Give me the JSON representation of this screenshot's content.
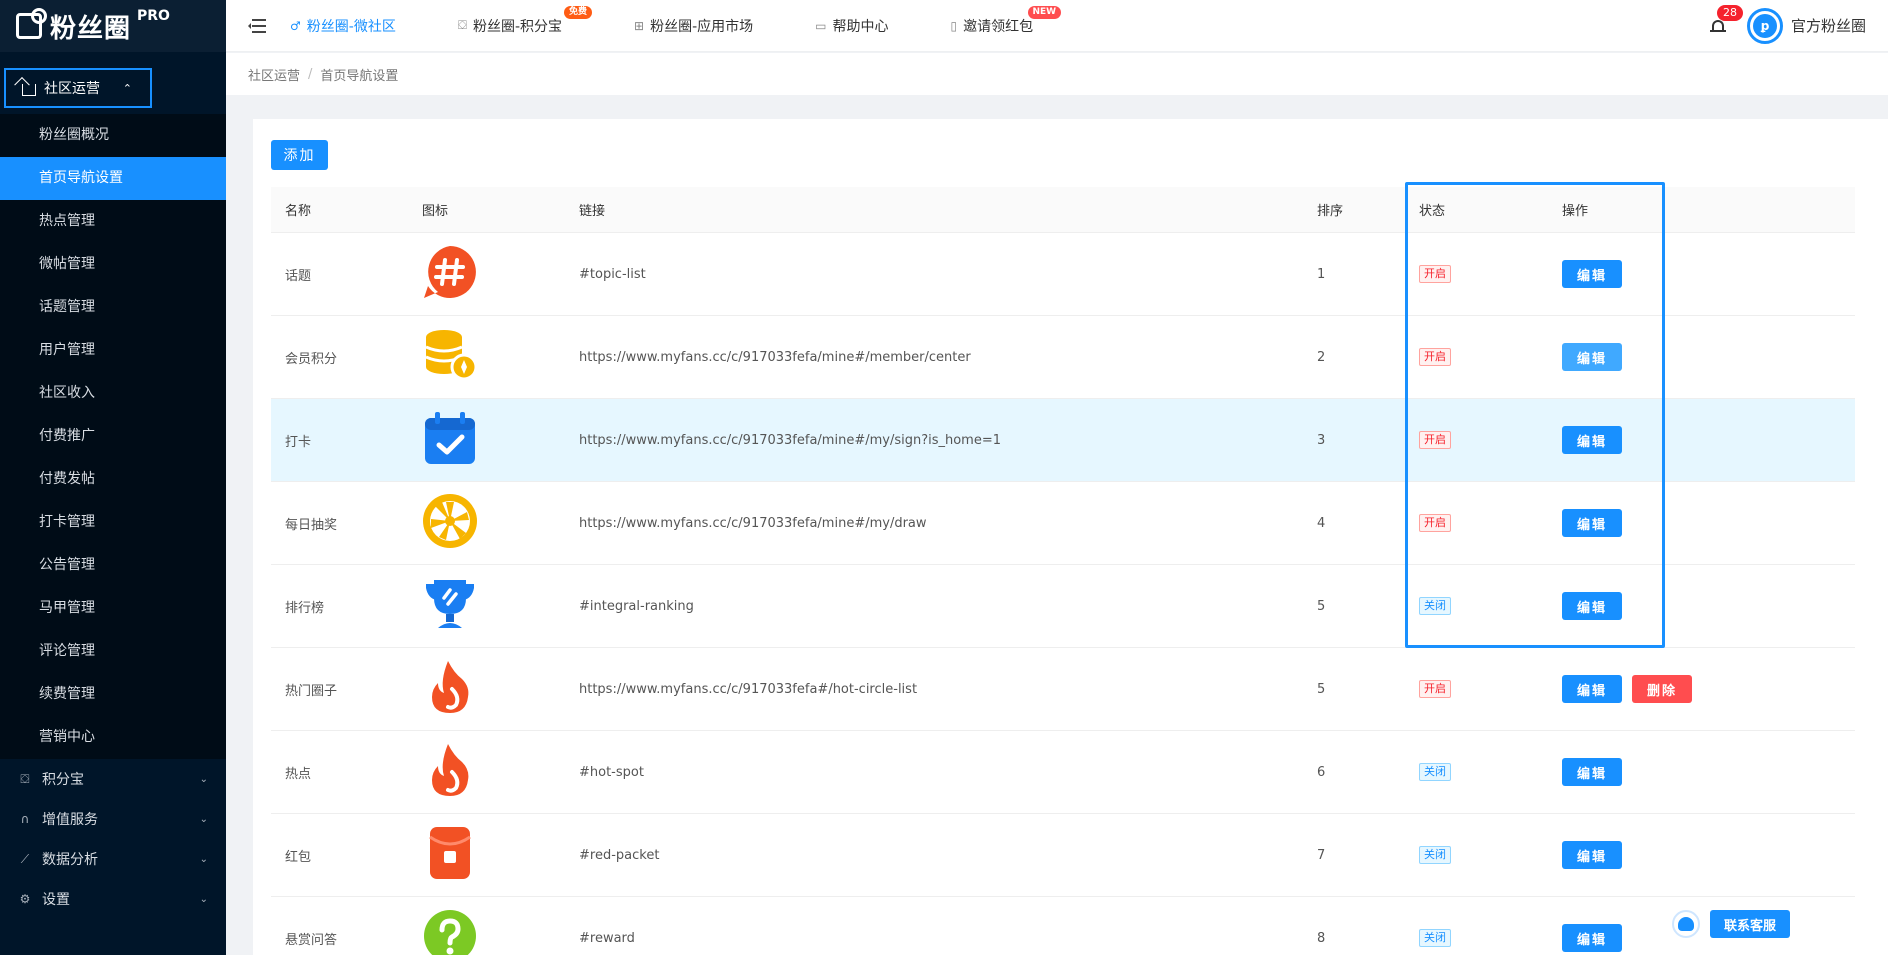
{
  "brand": {
    "name": "粉丝圈",
    "badge": "PRO"
  },
  "sidebar": {
    "group": {
      "label": "社区运营"
    },
    "items": [
      {
        "label": "粉丝圈概况",
        "active": false
      },
      {
        "label": "首页导航设置",
        "active": true
      },
      {
        "label": "热点管理",
        "active": false
      },
      {
        "label": "微帖管理",
        "active": false
      },
      {
        "label": "话题管理",
        "active": false
      },
      {
        "label": "用户管理",
        "active": false
      },
      {
        "label": "社区收入",
        "active": false
      },
      {
        "label": "付费推广",
        "active": false
      },
      {
        "label": "付费发帖",
        "active": false
      },
      {
        "label": "打卡管理",
        "active": false
      },
      {
        "label": "公告管理",
        "active": false
      },
      {
        "label": "马甲管理",
        "active": false
      },
      {
        "label": "评论管理",
        "active": false
      },
      {
        "label": "续费管理",
        "active": false
      },
      {
        "label": "营销中心",
        "active": false
      }
    ],
    "menus": [
      {
        "label": "积分宝",
        "icon": "gift-icon"
      },
      {
        "label": "增值服务",
        "icon": "headset-icon"
      },
      {
        "label": "数据分析",
        "icon": "chart-icon"
      },
      {
        "label": "设置",
        "icon": "gear-icon"
      }
    ]
  },
  "header": {
    "nav": [
      {
        "label": "粉丝圈-微社区",
        "active": true
      },
      {
        "label": "粉丝圈-积分宝",
        "badge": "免费"
      },
      {
        "label": "粉丝圈-应用市场"
      },
      {
        "label": "帮助中心"
      },
      {
        "label": "邀请领红包",
        "badge": "NEW"
      }
    ],
    "notifications": "28",
    "username": "官方粉丝圈"
  },
  "breadcrumb": {
    "root": "社区运营",
    "sep": "/",
    "current": "首页导航设置"
  },
  "actions": {
    "add": "添加",
    "edit": "编辑",
    "delete": "删除"
  },
  "table": {
    "columns": {
      "name": "名称",
      "icon": "图标",
      "link": "链接",
      "sort": "排序",
      "status": "状态",
      "ops": "操作"
    },
    "rows": [
      {
        "name": "话题",
        "icon": "hashtag-icon",
        "link": "#topic-list",
        "sort": "1",
        "status": "开启",
        "on": true
      },
      {
        "name": "会员积分",
        "icon": "coins-icon",
        "link": "https://www.myfans.cc/c/917033fefa/mine#/member/center",
        "sort": "2",
        "status": "开启",
        "on": true
      },
      {
        "name": "打卡",
        "icon": "calendar-check-icon",
        "link": "https://www.myfans.cc/c/917033fefa/mine#/my/sign?is_home=1",
        "sort": "3",
        "status": "开启",
        "on": true
      },
      {
        "name": "每日抽奖",
        "icon": "lucky-wheel-icon",
        "link": "https://www.myfans.cc/c/917033fefa/mine#/my/draw",
        "sort": "4",
        "status": "开启",
        "on": true
      },
      {
        "name": "排行榜",
        "icon": "trophy-icon",
        "link": "#integral-ranking",
        "sort": "5",
        "status": "关闭",
        "on": false
      },
      {
        "name": "热门圈子",
        "icon": "flame-icon",
        "link": "https://www.myfans.cc/c/917033fefa#/hot-circle-list",
        "sort": "5",
        "status": "开启",
        "on": true
      },
      {
        "name": "热点",
        "icon": "flame-icon",
        "link": "#hot-spot",
        "sort": "6",
        "status": "关闭",
        "on": false
      },
      {
        "name": "红包",
        "icon": "red-packet-icon",
        "link": "#red-packet",
        "sort": "7",
        "status": "关闭",
        "on": false
      },
      {
        "name": "悬赏问答",
        "icon": "question-icon",
        "link": "#reward",
        "sort": "8",
        "status": "关闭",
        "on": false
      }
    ]
  },
  "contact": {
    "label": "联系客服"
  }
}
